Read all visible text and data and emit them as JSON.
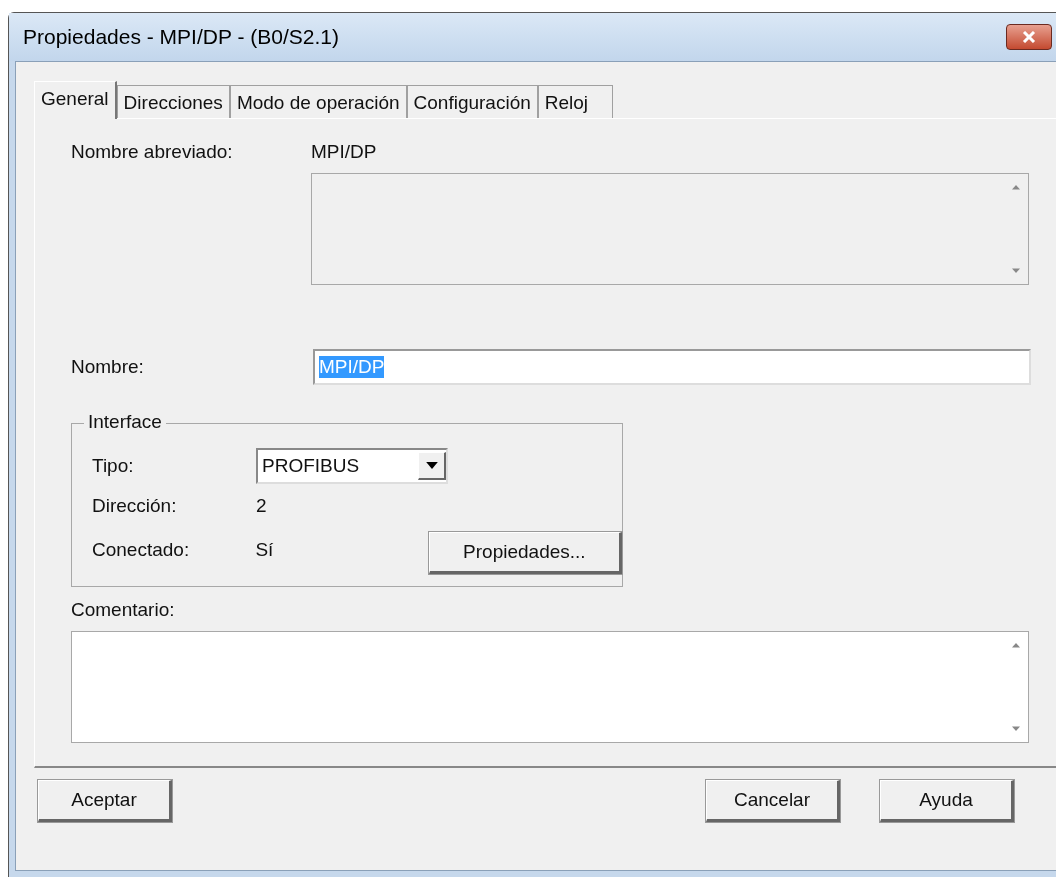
{
  "window": {
    "title": "Propiedades - MPI/DP - (B0/S2.1)"
  },
  "tabs": [
    {
      "label": "General",
      "selected": true
    },
    {
      "label": "Direcciones",
      "selected": false
    },
    {
      "label": "Modo de operación",
      "selected": false
    },
    {
      "label": "Configuración",
      "selected": false
    },
    {
      "label": "Reloj",
      "selected": false
    }
  ],
  "short_name": {
    "label": "Nombre abreviado:",
    "value": "MPI/DP"
  },
  "name": {
    "label": "Nombre:",
    "value": "MPI/DP",
    "text_selected": true
  },
  "interface": {
    "title": "Interface",
    "type_label": "Tipo:",
    "type_value": "PROFIBUS",
    "address_label": "Dirección:",
    "address_value": "2",
    "connected_label": "Conectado:",
    "connected_value": "Sí",
    "properties_button": "Propiedades..."
  },
  "comment": {
    "label": "Comentario:"
  },
  "buttons": {
    "ok": "Aceptar",
    "cancel": "Cancelar",
    "help": "Ayuda"
  }
}
